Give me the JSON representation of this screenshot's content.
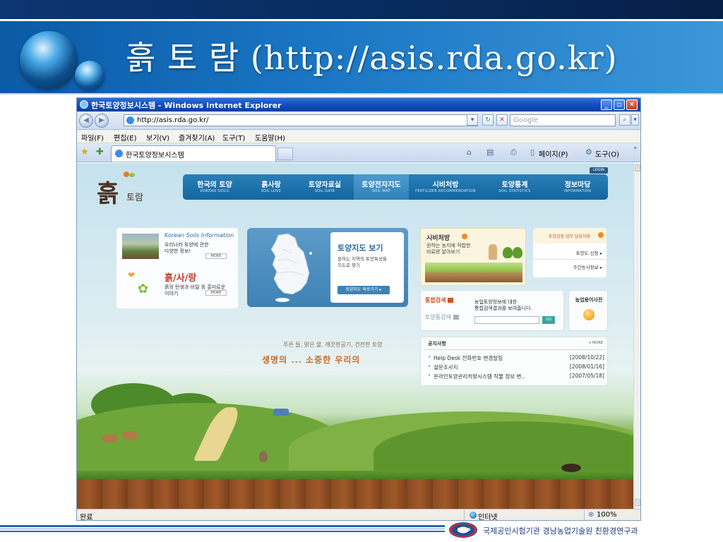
{
  "slide": {
    "title": "흙 토 람 (http://asis.rda.go.kr)",
    "footer_credit": "국제공인시험기관 경남농업기술원 친환경연구과",
    "logo_text": "KOLAS"
  },
  "browser": {
    "window_title": "한국토양정보시스템 - Windows Internet Explorer",
    "address": "http://asis.rda.go.kr/",
    "search_placeholder": "Google",
    "menu": [
      "파일(F)",
      "편집(E)",
      "보기(V)",
      "즐겨찾기(A)",
      "도구(T)",
      "도움말(H)"
    ],
    "tab_title": "한국토양정보시스템",
    "commands": {
      "page": "페이지(P)",
      "tools": "도구(O)"
    },
    "status": {
      "text": "완료",
      "zone": "인터넷",
      "zoom": "100%"
    }
  },
  "site": {
    "logo": {
      "main": "흙",
      "sub": "토람"
    },
    "login": "LOGIN",
    "nav": [
      {
        "ko": "한국의 토양",
        "en": "KOREAN SOILS"
      },
      {
        "ko": "흙사랑",
        "en": "SOIL LOVE"
      },
      {
        "ko": "토양자료실",
        "en": "SOIL DATA"
      },
      {
        "ko": "토양전자지도",
        "en": "SOIL MAP"
      },
      {
        "ko": "시비처방",
        "en": "FERTILIZER RECOMMENDATION"
      },
      {
        "ko": "토양통계",
        "en": "SOIL STATISTICS"
      },
      {
        "ko": "정보마당",
        "en": "INFORMATION"
      }
    ],
    "ksi": {
      "title": "Korean Soils Information",
      "desc1": "우리나라 토양에 관한",
      "desc2": "다양한 정보!",
      "more": "MORE"
    },
    "heuksarang": {
      "title": "흙/사/랑",
      "desc1": "흙의 탄생과 비밀 등 흥미로운",
      "desc2": "이야기",
      "more": "MORE"
    },
    "soilmap": {
      "title": "토양지도 보기",
      "desc1": "원하는 지역의 토양특성을",
      "desc2": "지도로 찾기",
      "button": "토양지도 바로가기"
    },
    "fertilizer": {
      "title": "시비처방",
      "desc1": "원하는 농지에 적합한",
      "desc2": "비료량 알아보기"
    },
    "soil_card": {
      "title": "토양검정 업무 담당자용",
      "links": [
        "토양도 신청",
        "주간농사정보"
      ]
    },
    "search": {
      "tab_active": "통합검색",
      "tab_inactive": "토양통검색",
      "desc1": "농업토양정보에 대한",
      "desc2": "통합검색결과를 보여줍니다.",
      "go": "GO"
    },
    "dictionary": {
      "title": "농업용어사전"
    },
    "slogan": {
      "small": "푸른 들, 맑은 물, 깨끗한공기, 건전한 토양",
      "big": "생명의 ... 소중한 우리의"
    },
    "notices": {
      "title": "공지사항",
      "more": "MORE",
      "items": [
        {
          "text": "Help Desk 전화번호 변경알림",
          "date": "[2008/10/22]"
        },
        {
          "text": "설문조사지",
          "date": "[2008/01/16]"
        },
        {
          "text": "온라인토양관리처방시스템 작물 정보 변..",
          "date": "[2007/05/18]"
        }
      ]
    }
  }
}
